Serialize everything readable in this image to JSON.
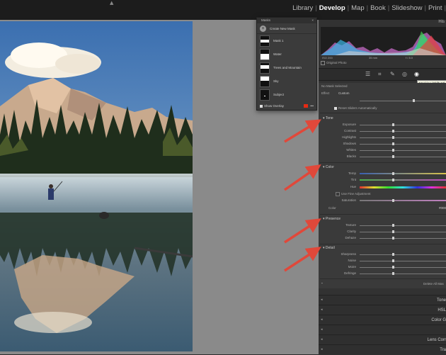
{
  "modules": [
    "Library",
    "Develop",
    "Map",
    "Book",
    "Slideshow",
    "Print"
  ],
  "active_module": "Develop",
  "mask_panel": {
    "title": "Masks",
    "create_label": "Create New Mask",
    "items": [
      "Mask 1",
      "Water",
      "Trees and Mountain",
      "Sky",
      "Subject"
    ],
    "show_overlay_label": "Show Overlay",
    "overlay_color": "#e52a14"
  },
  "histogram": {
    "title": "His",
    "info_left": "ISO 200",
    "info_mid": "35 mm",
    "info_right": "f / 8.0",
    "original_photo_label": "Original Photo"
  },
  "tooltip": "Masking (Shift+M)",
  "adjustments": {
    "no_mask_label": "No Mask Selected",
    "effect_label": "Effect",
    "effect_value": "Custom",
    "reset_label": "Reset Sliders Automatically",
    "sections": {
      "tone": {
        "title": "Tone",
        "sliders": [
          "Exposure",
          "Contrast",
          "Highlights",
          "Shadows",
          "Whites",
          "Blacks"
        ]
      },
      "color": {
        "title": "Color",
        "sliders": [
          "Temp",
          "Tint",
          "Hue"
        ],
        "fine_label": "Use Fine Adjustment",
        "saturation_label": "Saturation",
        "color_label": "Color",
        "color_value": "#0000"
      },
      "presence": {
        "title": "Presence",
        "sliders": [
          "Texture",
          "Clarity",
          "Dehaze"
        ]
      },
      "detail": {
        "title": "Detail",
        "sliders": [
          "Sharpness",
          "Noise",
          "Moire",
          "Defringe"
        ]
      }
    },
    "delete_label": "Delete All Mas"
  },
  "collapsed_panels": [
    "Tone",
    "HSL",
    "Color G",
    "",
    "Lens Corr",
    "Tra"
  ],
  "colors": {
    "arrow": "#e0483a",
    "accent_red": "#e52a14"
  }
}
